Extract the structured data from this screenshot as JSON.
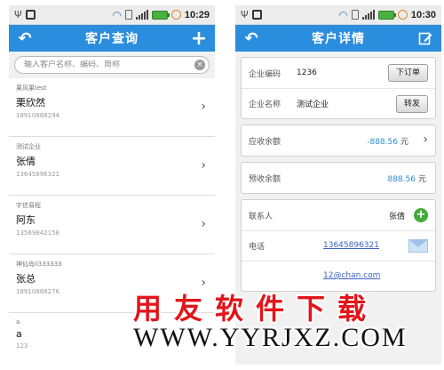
{
  "statusbar": {
    "time": "10:29",
    "time_right": "10:30"
  },
  "left": {
    "title": "客户查询",
    "search_placeholder": "输入客户名称、编码、简称",
    "customers": [
      {
        "company": "果风果test",
        "name": "栗欣然",
        "phone": "18910888294"
      },
      {
        "company": "测试企业",
        "name": "张倩",
        "phone": "13645896321"
      },
      {
        "company": "宇信易程",
        "name": "阿东",
        "phone": "13569842158"
      },
      {
        "company": "神仙岛il333333",
        "name": "张总",
        "phone": "18910888276"
      },
      {
        "company": "a",
        "name": "a",
        "phone": "123"
      }
    ]
  },
  "right": {
    "title": "客户详情",
    "code_label": "企业编码",
    "code_value": "1236",
    "order_button": "下订单",
    "name_label": "企业名称",
    "name_value": "测试企业",
    "transfer_button": "转发",
    "receivable_label": "应收余额",
    "receivable_value": "-888.56",
    "receivable_unit": "元",
    "prepaid_label": "预收余额",
    "prepaid_value": "888.56",
    "prepaid_unit": "元",
    "contact_label": "联系人",
    "contact_value": "张倩",
    "phone_label": "电话",
    "phone_value": "13645896321",
    "email_value": "12@chan.com"
  },
  "watermark": {
    "cn": "用友软件下载",
    "url": "WWW.YYRJXZ.COM"
  },
  "colors": {
    "titlebar": "#2b8ddd",
    "accent_amount": "#2a8fd6",
    "watermark_red": "#e2151a"
  }
}
